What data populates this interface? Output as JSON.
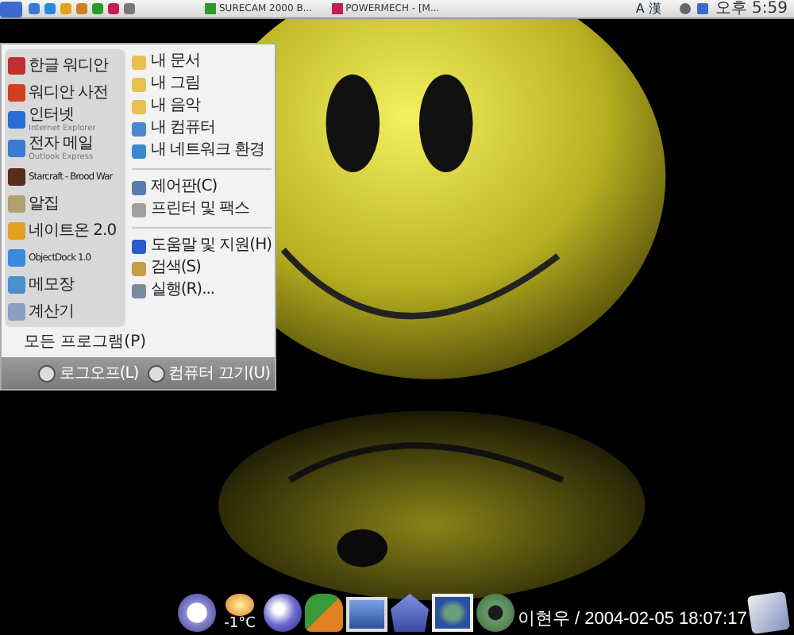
{
  "top_bar": {
    "tasks": [
      {
        "label": "SURECAM 2000 B...",
        "color": "#2e9a2e"
      },
      {
        "label": "POWERMECH - [M...",
        "color": "#c02050"
      }
    ],
    "ime": "A 漢",
    "clock": "오후 5:59"
  },
  "start_menu": {
    "pinned": [
      {
        "title": "한글 워디안",
        "color": "#c03030"
      },
      {
        "title": "워디안 사전",
        "color": "#d04020"
      },
      {
        "title": "인터넷",
        "subtitle": "Internet Explorer",
        "color": "#2a6ad8"
      },
      {
        "title": "전자 메일",
        "subtitle": "Outlook Express",
        "color": "#3a7ad0"
      },
      {
        "title": "Starcraft - Brood War",
        "color": "#5a2a1a"
      },
      {
        "title": "알집",
        "color": "#b0a070"
      },
      {
        "title": "네이트온 2.0",
        "color": "#e0a020"
      },
      {
        "title": "ObjectDock 1.0",
        "color": "#3a8ae0"
      },
      {
        "title": "메모장",
        "color": "#4a90d0"
      },
      {
        "title": "계산기",
        "color": "#8aa0c0"
      }
    ],
    "places": [
      {
        "items": [
          {
            "label": "내 문서",
            "color": "#e8c050"
          },
          {
            "label": "내 그림",
            "color": "#e8c050"
          },
          {
            "label": "내 음악",
            "color": "#e8c050"
          },
          {
            "label": "내 컴퓨터",
            "color": "#4a8ad0"
          },
          {
            "label": "내 네트워크 환경",
            "color": "#3a8ad0"
          }
        ]
      },
      {
        "items": [
          {
            "label": "제어판(C)",
            "color": "#5a7ab0"
          },
          {
            "label": "프린터 및 팩스",
            "color": "#a0a0a0"
          }
        ]
      },
      {
        "items": [
          {
            "label": "도움말 및 지원(H)",
            "color": "#2a5ad0"
          },
          {
            "label": "검색(S)",
            "color": "#c0a040"
          },
          {
            "label": "실행(R)...",
            "color": "#7a8aa0"
          }
        ]
      }
    ],
    "all_programs": "모든 프로그램(P)",
    "logoff": "로그오프(L)",
    "shutdown": "컴퓨터 끄기(U)"
  },
  "dock": {
    "weather": "-1°C",
    "caption": "이현우 / 2004-02-05 18:07:17"
  }
}
